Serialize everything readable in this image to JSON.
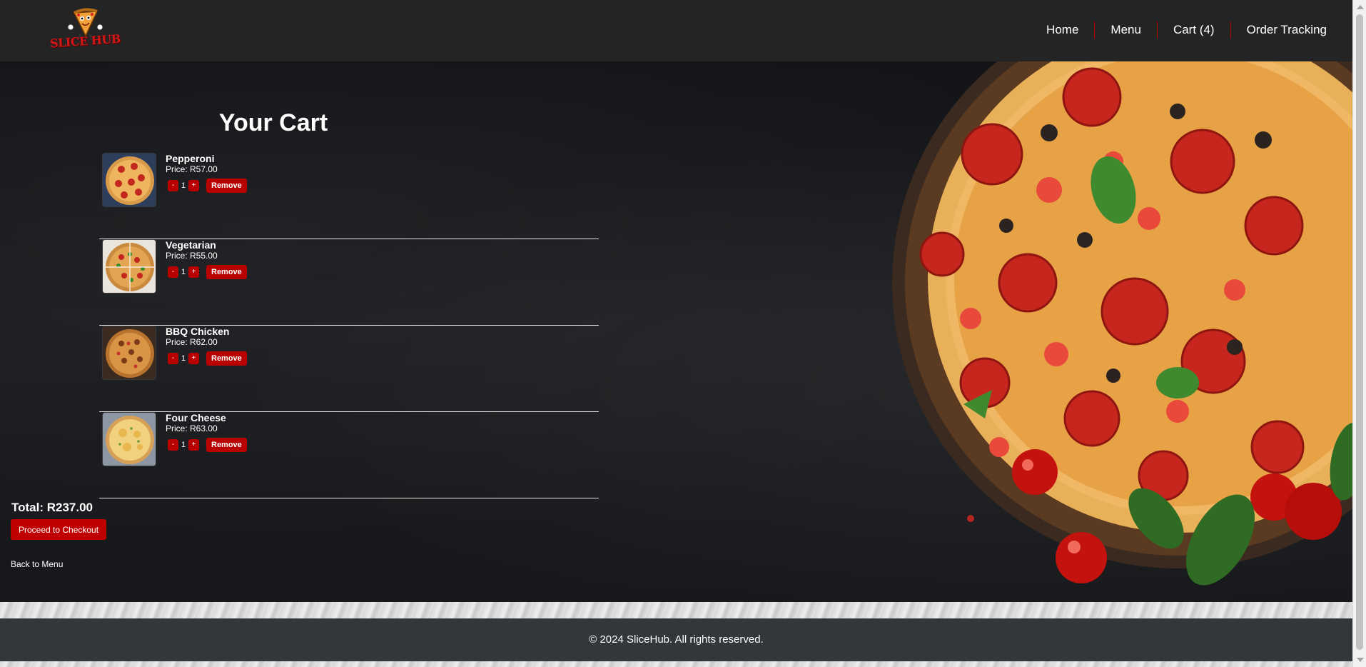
{
  "brand": {
    "logo_text": "SLICE HUB",
    "accent": "#b80000"
  },
  "nav": {
    "items": [
      {
        "label": "Home"
      },
      {
        "label": "Menu"
      },
      {
        "label": "Cart (4)"
      },
      {
        "label": "Order Tracking"
      }
    ]
  },
  "cart": {
    "title": "Your Cart",
    "items": [
      {
        "name": "Pepperoni",
        "price": "Price: R57.00",
        "qty": "1",
        "minus": "-",
        "plus": "+",
        "remove": "Remove",
        "thumb": "pepperoni-pizza"
      },
      {
        "name": "Vegetarian",
        "price": "Price: R55.00",
        "qty": "1",
        "minus": "-",
        "plus": "+",
        "remove": "Remove",
        "thumb": "vegetarian-pizza"
      },
      {
        "name": "BBQ Chicken",
        "price": "Price: R62.00",
        "qty": "1",
        "minus": "-",
        "plus": "+",
        "remove": "Remove",
        "thumb": "bbq-chicken-pizza"
      },
      {
        "name": "Four Cheese",
        "price": "Price: R63.00",
        "qty": "1",
        "minus": "-",
        "plus": "+",
        "remove": "Remove",
        "thumb": "four-cheese-pizza"
      }
    ],
    "total": "Total: R237.00",
    "checkout_label": "Proceed to Checkout",
    "back_label": "Back to Menu"
  },
  "footer": {
    "text": "© 2024 SliceHub. All rights reserved."
  }
}
